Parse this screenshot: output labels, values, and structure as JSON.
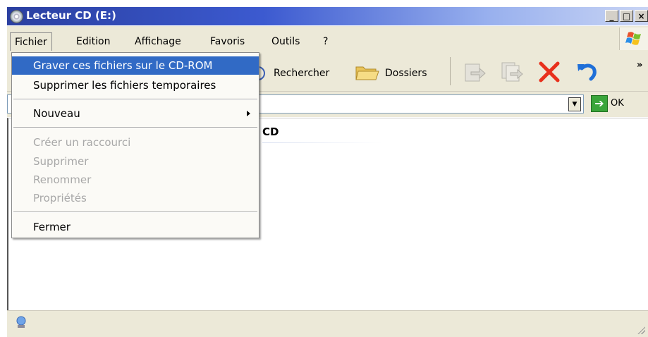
{
  "window": {
    "title": "Lecteur CD (E:)"
  },
  "menubar": {
    "items": [
      "Fichier",
      "Edition",
      "Affichage",
      "Favoris",
      "Outils",
      "?"
    ]
  },
  "toolbar": {
    "search_label": "Rechercher",
    "folders_label": "Dossiers",
    "more": "»"
  },
  "addressbar": {
    "go_label": "OK"
  },
  "content": {
    "drive_label": "CD"
  },
  "file_menu": {
    "items": [
      {
        "label": "Graver ces fichiers sur le CD-ROM",
        "state": "highlighted"
      },
      {
        "label": "Supprimer les fichiers temporaires",
        "state": "enabled"
      },
      {
        "label": "Nouveau",
        "state": "submenu"
      },
      {
        "label": "Créer un raccourci",
        "state": "disabled"
      },
      {
        "label": "Supprimer",
        "state": "disabled"
      },
      {
        "label": "Renommer",
        "state": "disabled"
      },
      {
        "label": "Propriétés",
        "state": "disabled"
      },
      {
        "label": "Fermer",
        "state": "enabled"
      }
    ]
  },
  "colors": {
    "highlight": "#316ac5",
    "titlebar": "#2a3fa0",
    "chrome": "#ece9d8",
    "disabled_text": "#a8a8a8"
  }
}
